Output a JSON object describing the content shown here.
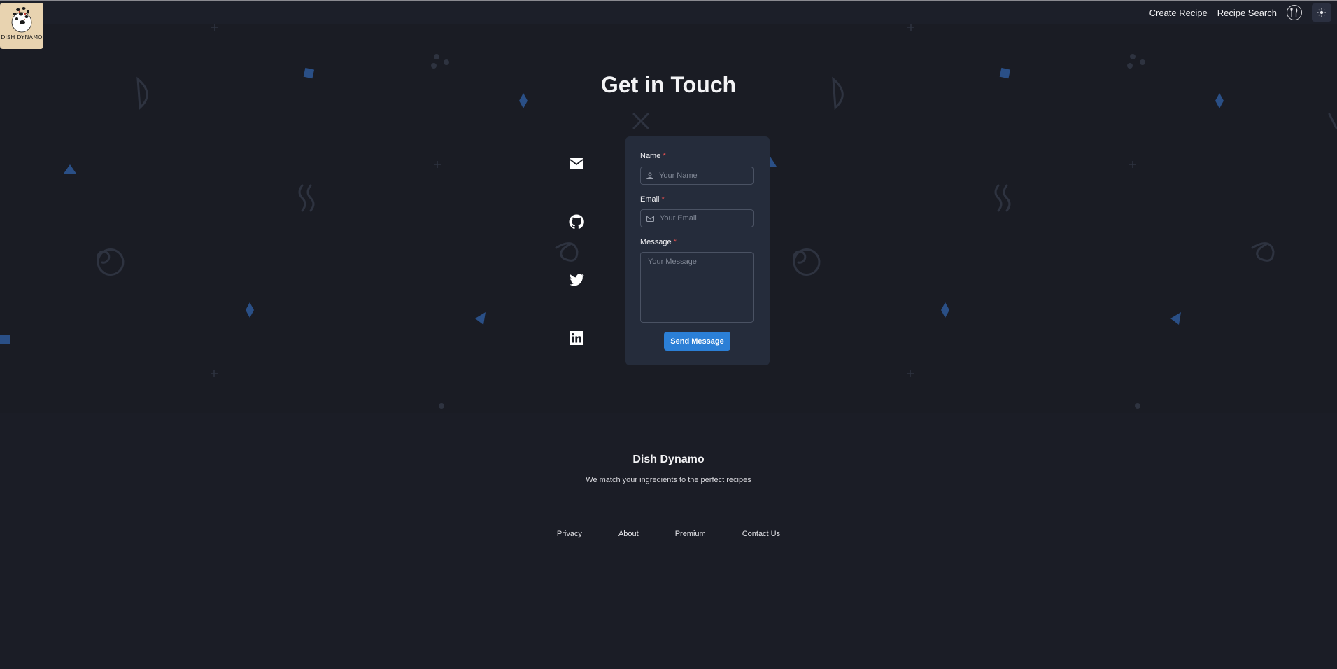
{
  "brand": {
    "logo_text": "DISH DYNAMO"
  },
  "nav": {
    "links": [
      "Create Recipe",
      "Recipe Search"
    ],
    "utensils_icon": "utensils-icon",
    "theme_icon": "sun-icon"
  },
  "page": {
    "title": "Get in Touch"
  },
  "social": [
    {
      "icon": "mail-icon"
    },
    {
      "icon": "github-icon"
    },
    {
      "icon": "twitter-icon"
    },
    {
      "icon": "linkedin-icon"
    }
  ],
  "form": {
    "name_label": "Name",
    "name_placeholder": "Your Name",
    "email_label": "Email",
    "email_placeholder": "Your Email",
    "message_label": "Message",
    "message_placeholder": "Your Message",
    "required_mark": "*",
    "submit_label": "Send Message"
  },
  "footer": {
    "title": "Dish Dynamo",
    "tagline": "We match your ingredients to the perfect recipes",
    "links": [
      "Privacy",
      "About",
      "Premium",
      "Contact Us"
    ]
  },
  "colors": {
    "background": "#1a1c24",
    "card": "#252c3b",
    "accent": "#2b7fd6",
    "required": "#e35050",
    "logo_bg": "#e8d3b0"
  }
}
